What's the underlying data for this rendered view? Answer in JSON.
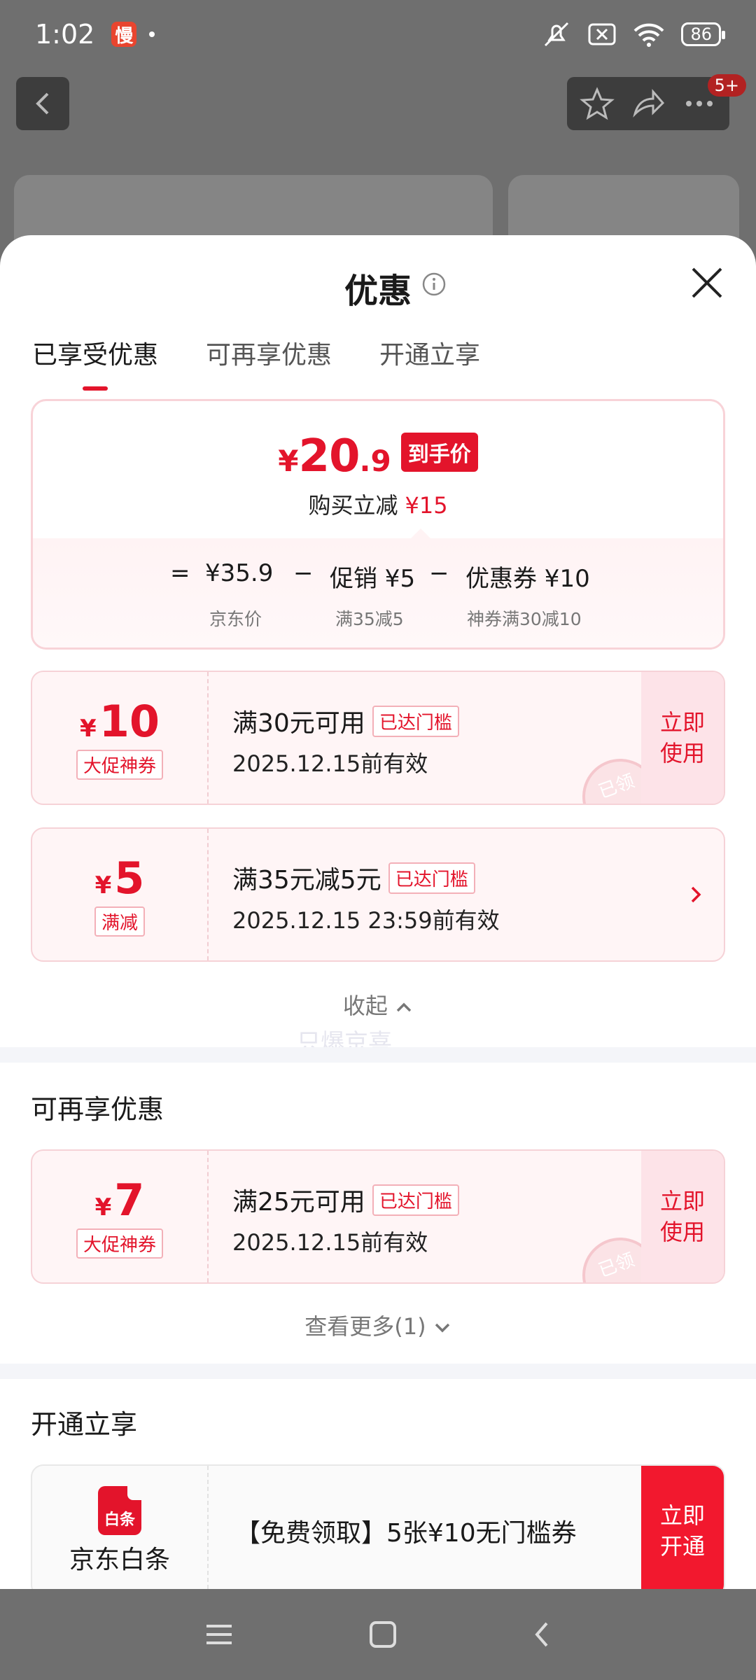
{
  "status_bar": {
    "time": "1:02",
    "app_badge": "慢",
    "battery": "86"
  },
  "top_nav": {
    "cart_badge": "5+"
  },
  "sheet": {
    "title": "优惠",
    "tabs": [
      {
        "label": "已享受优惠",
        "active": true
      },
      {
        "label": "可再享优惠",
        "active": false
      },
      {
        "label": "开通立享",
        "active": false
      }
    ],
    "summary": {
      "price_symbol": "¥",
      "price_int": "20",
      "price_dec": ".9",
      "final_tag": "到手价",
      "reduce_label": "购买立减",
      "reduce_amount": "¥15",
      "equals": "=",
      "jd_price": "¥35.9",
      "minus1": "−",
      "promo": "促销 ¥5",
      "minus2": "−",
      "coupon": "优惠券 ¥10",
      "jd_price_label": "京东价",
      "promo_label": "满35减5",
      "coupon_label": "神券满30减10"
    },
    "used_coupons": [
      {
        "symbol": "¥",
        "value": "10",
        "type": "大促神券",
        "condition": "满30元可用",
        "threshold": "已达门槛",
        "expiry": "2025.12.15前有效",
        "action": "立即使用",
        "stamp": "已领"
      },
      {
        "symbol": "¥",
        "value": "5",
        "type": "满减",
        "condition": "满35元减5元",
        "threshold": "已达门槛",
        "expiry": "2025.12.15 23:59前有效"
      }
    ],
    "collapse_label": "收起",
    "watermark": "只爆京喜",
    "more_section": {
      "title": "可再享优惠",
      "coupon": {
        "symbol": "¥",
        "value": "7",
        "type": "大促神券",
        "condition": "满25元可用",
        "threshold": "已达门槛",
        "expiry": "2025.12.15前有效",
        "action": "立即使用",
        "stamp": "已领"
      },
      "see_more": "查看更多(1)"
    },
    "open_section": {
      "title": "开通立享",
      "logo_text": "白条",
      "name": "京东白条",
      "offer": "【免费领取】5张¥10无门槛券",
      "action": "立即开通"
    }
  },
  "colors": {
    "accent": "#e3142b",
    "coupon_bg": "#fff5f6",
    "overlay": "#6f6f6f"
  }
}
